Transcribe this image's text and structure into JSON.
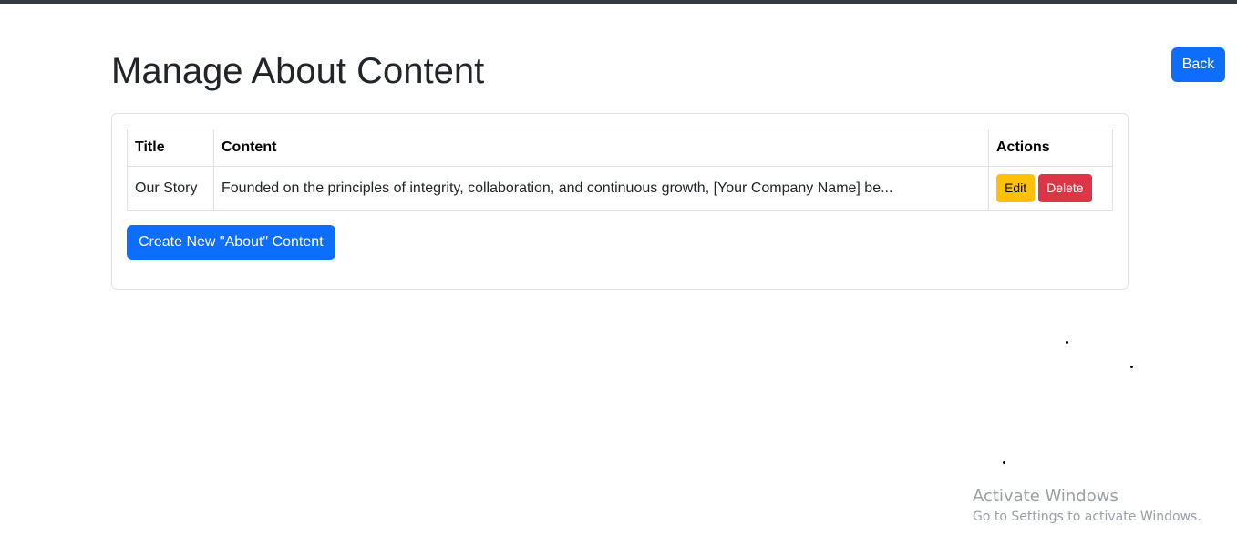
{
  "page": {
    "title": "Manage About Content",
    "back_label": "Back"
  },
  "table": {
    "headers": {
      "title": "Title",
      "content": "Content",
      "actions": "Actions"
    },
    "rows": [
      {
        "title": "Our Story",
        "content": "Founded on the principles of integrity, collaboration, and continuous growth, [Your Company Name] be...",
        "edit_label": "Edit",
        "delete_label": "Delete"
      }
    ]
  },
  "create_label": "Create New \"About\" Content",
  "watermark": {
    "title": "Activate Windows",
    "subtitle": "Go to Settings to activate Windows."
  },
  "colors": {
    "primary": "#0d6efd",
    "warning": "#ffc107",
    "danger": "#dc3545",
    "border": "#dee2e6"
  }
}
